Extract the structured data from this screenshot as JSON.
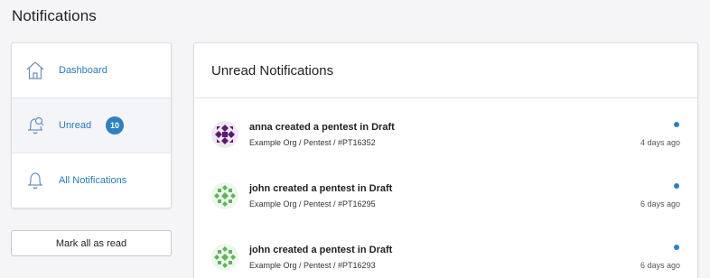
{
  "page": {
    "title": "Notifications"
  },
  "sidebar": {
    "items": [
      {
        "label": "Dashboard",
        "icon": "home-icon"
      },
      {
        "label": "Unread",
        "icon": "bell-search-icon",
        "badge": "10"
      },
      {
        "label": "All Notifications",
        "icon": "bell-icon"
      }
    ]
  },
  "actions": {
    "mark_all_read": "Mark all as read"
  },
  "panel": {
    "title": "Unread Notifications",
    "notifications": [
      {
        "title": "anna created a pentest in Draft",
        "subtitle": "Example Org / Pentest / #PT16352",
        "time": "4 days ago",
        "avatar_color": "#5a1a6e"
      },
      {
        "title": "john created a pentest in Draft",
        "subtitle": "Example Org / Pentest / #PT16295",
        "time": "6 days ago",
        "avatar_color": "#5fb55a"
      },
      {
        "title": "john created a pentest in Draft",
        "subtitle": "Example Org / Pentest / #PT16293",
        "time": "6 days ago",
        "avatar_color": "#5fb55a"
      }
    ]
  },
  "colors": {
    "accent": "#2f7fc1",
    "link": "#2a7ab8"
  }
}
